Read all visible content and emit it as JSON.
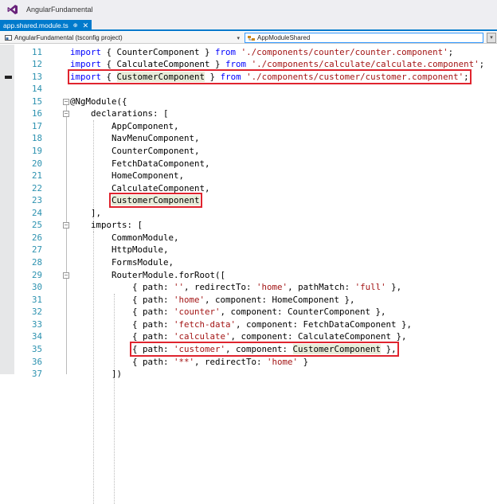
{
  "window": {
    "title": "AngularFundamental",
    "logo_icon": "visual-studio-icon"
  },
  "tab": {
    "label": "app.shared.module.ts",
    "pin_icon": "pin-icon",
    "close_icon": "close-icon",
    "color": "#007acc"
  },
  "navbar": {
    "project": "AngularFundamental (tsconfig project)",
    "member": "AppModuleShared"
  },
  "colors": {
    "keyword": "#0000ff",
    "string": "#a31515",
    "line_number": "#2b91af",
    "highlight_box": "#e0242e"
  },
  "lines": [
    {
      "n": "11",
      "indent": 0,
      "tokens": [
        [
          "kw",
          "import"
        ],
        [
          "p",
          " { CounterComponent } "
        ],
        [
          "kw",
          "from"
        ],
        [
          "p",
          " "
        ],
        [
          "str",
          "'./components/counter/counter.component'"
        ],
        [
          "p",
          ";"
        ]
      ]
    },
    {
      "n": "12",
      "indent": 0,
      "tokens": [
        [
          "kw",
          "import"
        ],
        [
          "p",
          " { CalculateComponent } "
        ],
        [
          "kw",
          "from"
        ],
        [
          "p",
          " "
        ],
        [
          "str",
          "'./components/calculate/calculate.component'"
        ],
        [
          "p",
          ";"
        ]
      ]
    },
    {
      "n": "13",
      "indent": 0,
      "bookmark": true,
      "box": true,
      "tokens": [
        [
          "kw",
          "import"
        ],
        [
          "p",
          " { "
        ],
        [
          "hl",
          "CustomerComponent"
        ],
        [
          "p",
          " } "
        ],
        [
          "kw",
          "from"
        ],
        [
          "p",
          " "
        ],
        [
          "str",
          "'./components/customer/customer.component'"
        ],
        [
          "p",
          ";"
        ]
      ]
    },
    {
      "n": "14",
      "indent": 0,
      "tokens": []
    },
    {
      "n": "15",
      "indent": 0,
      "fold": true,
      "tokens": [
        [
          "p",
          "@NgModule({"
        ]
      ]
    },
    {
      "n": "16",
      "indent": 4,
      "fold": true,
      "tokens": [
        [
          "p",
          "declarations: ["
        ]
      ]
    },
    {
      "n": "17",
      "indent": 8,
      "tokens": [
        [
          "p",
          "AppComponent,"
        ]
      ]
    },
    {
      "n": "18",
      "indent": 8,
      "tokens": [
        [
          "p",
          "NavMenuComponent,"
        ]
      ]
    },
    {
      "n": "19",
      "indent": 8,
      "tokens": [
        [
          "p",
          "CounterComponent,"
        ]
      ]
    },
    {
      "n": "20",
      "indent": 8,
      "tokens": [
        [
          "p",
          "FetchDataComponent,"
        ]
      ]
    },
    {
      "n": "21",
      "indent": 8,
      "tokens": [
        [
          "p",
          "HomeComponent,"
        ]
      ]
    },
    {
      "n": "22",
      "indent": 8,
      "tokens": [
        [
          "p",
          "CalculateComponent,"
        ]
      ]
    },
    {
      "n": "23",
      "indent": 8,
      "box": true,
      "tokens": [
        [
          "hl",
          "CustomerComponent"
        ]
      ]
    },
    {
      "n": "24",
      "indent": 4,
      "tokens": [
        [
          "p",
          "],"
        ]
      ]
    },
    {
      "n": "25",
      "indent": 4,
      "fold": true,
      "tokens": [
        [
          "p",
          "imports: ["
        ]
      ]
    },
    {
      "n": "26",
      "indent": 8,
      "tokens": [
        [
          "p",
          "CommonModule,"
        ]
      ]
    },
    {
      "n": "27",
      "indent": 8,
      "tokens": [
        [
          "p",
          "HttpModule,"
        ]
      ]
    },
    {
      "n": "28",
      "indent": 8,
      "tokens": [
        [
          "p",
          "FormsModule,"
        ]
      ]
    },
    {
      "n": "29",
      "indent": 8,
      "fold": true,
      "tokens": [
        [
          "p",
          "RouterModule.forRoot(["
        ]
      ]
    },
    {
      "n": "30",
      "indent": 12,
      "tokens": [
        [
          "p",
          "{ path: "
        ],
        [
          "str",
          "''"
        ],
        [
          "p",
          ", redirectTo: "
        ],
        [
          "str",
          "'home'"
        ],
        [
          "p",
          ", pathMatch: "
        ],
        [
          "str",
          "'full'"
        ],
        [
          "p",
          " },"
        ]
      ]
    },
    {
      "n": "31",
      "indent": 12,
      "tokens": [
        [
          "p",
          "{ path: "
        ],
        [
          "str",
          "'home'"
        ],
        [
          "p",
          ", component: HomeComponent },"
        ]
      ]
    },
    {
      "n": "32",
      "indent": 12,
      "tokens": [
        [
          "p",
          "{ path: "
        ],
        [
          "str",
          "'counter'"
        ],
        [
          "p",
          ", component: CounterComponent },"
        ]
      ]
    },
    {
      "n": "33",
      "indent": 12,
      "tokens": [
        [
          "p",
          "{ path: "
        ],
        [
          "str",
          "'fetch-data'"
        ],
        [
          "p",
          ", component: FetchDataComponent },"
        ]
      ]
    },
    {
      "n": "34",
      "indent": 12,
      "tokens": [
        [
          "p",
          "{ path: "
        ],
        [
          "str",
          "'calculate'"
        ],
        [
          "p",
          ", component: CalculateComponent },"
        ]
      ]
    },
    {
      "n": "35",
      "indent": 12,
      "box": true,
      "tokens": [
        [
          "p",
          "{ path: "
        ],
        [
          "str",
          "'customer'"
        ],
        [
          "p",
          ", component: "
        ],
        [
          "hl",
          "CustomerComponent"
        ],
        [
          "p",
          " },"
        ]
      ]
    },
    {
      "n": "36",
      "indent": 12,
      "tokens": [
        [
          "p",
          "{ path: "
        ],
        [
          "str",
          "'**'"
        ],
        [
          "p",
          ", redirectTo: "
        ],
        [
          "str",
          "'home'"
        ],
        [
          "p",
          " }"
        ]
      ]
    },
    {
      "n": "37",
      "indent": 8,
      "tokens": [
        [
          "p",
          "])"
        ]
      ]
    }
  ]
}
